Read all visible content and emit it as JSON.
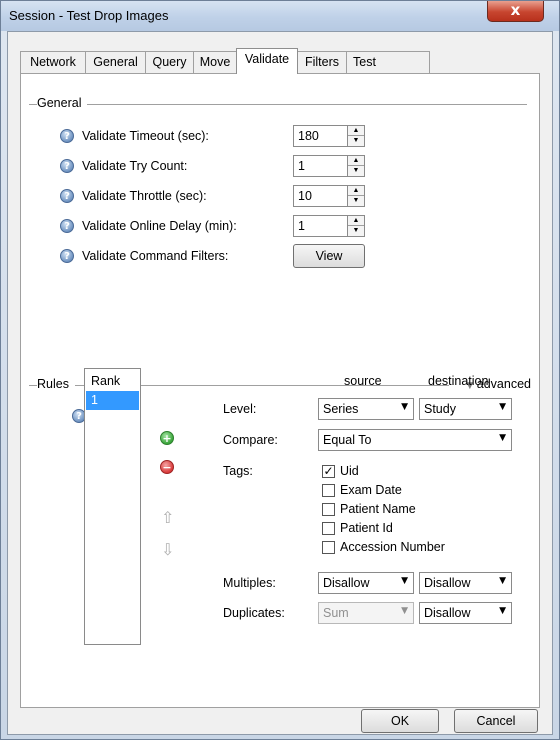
{
  "window": {
    "title": "Session - Test Drop Images",
    "close_glyph": "x"
  },
  "tabs": [
    {
      "label": "Network"
    },
    {
      "label": "General"
    },
    {
      "label": "Query"
    },
    {
      "label": "Move"
    },
    {
      "label": "Validate",
      "active": true
    },
    {
      "label": "Filters"
    },
    {
      "label": "Test"
    }
  ],
  "general": {
    "title": "General",
    "rows": [
      {
        "label": "Validate Timeout (sec):",
        "value": "180"
      },
      {
        "label": "Validate Try Count:",
        "value": "1"
      },
      {
        "label": "Validate Throttle (sec):",
        "value": "10"
      },
      {
        "label": "Validate Online Delay (min):",
        "value": "1"
      }
    ],
    "command_filters": {
      "label": "Validate Command Filters:",
      "button": "View"
    }
  },
  "rules": {
    "title": "Rules",
    "advanced": "advanced",
    "rank_header": "Rank",
    "rank_items": [
      "1"
    ],
    "source_header": "source",
    "destination_header": "destination",
    "level": {
      "label": "Level:",
      "source": "Series",
      "destination": "Study"
    },
    "compare": {
      "label": "Compare:",
      "value": "Equal To"
    },
    "tags": {
      "label": "Tags:",
      "items": [
        {
          "label": "Uid",
          "checked": true
        },
        {
          "label": "Exam Date",
          "checked": false
        },
        {
          "label": "Patient Name",
          "checked": false
        },
        {
          "label": "Patient Id",
          "checked": false
        },
        {
          "label": "Accession Number",
          "checked": false
        }
      ]
    },
    "multiples": {
      "label": "Multiples:",
      "source": "Disallow",
      "destination": "Disallow"
    },
    "duplicates": {
      "label": "Duplicates:",
      "source": "Sum",
      "destination": "Disallow"
    }
  },
  "footer": {
    "ok": "OK",
    "cancel": "Cancel"
  },
  "colors": {
    "selection": "#3399ff",
    "add": "#3aa53a",
    "remove": "#d93a3a",
    "help": "#6f93c1"
  },
  "icons": {
    "help": "help-icon",
    "add": "add-icon",
    "remove": "remove-icon",
    "move_up": "arrow-up-icon",
    "move_down": "arrow-down-icon",
    "advanced": "triangle-down-icon",
    "close": "close-icon"
  }
}
